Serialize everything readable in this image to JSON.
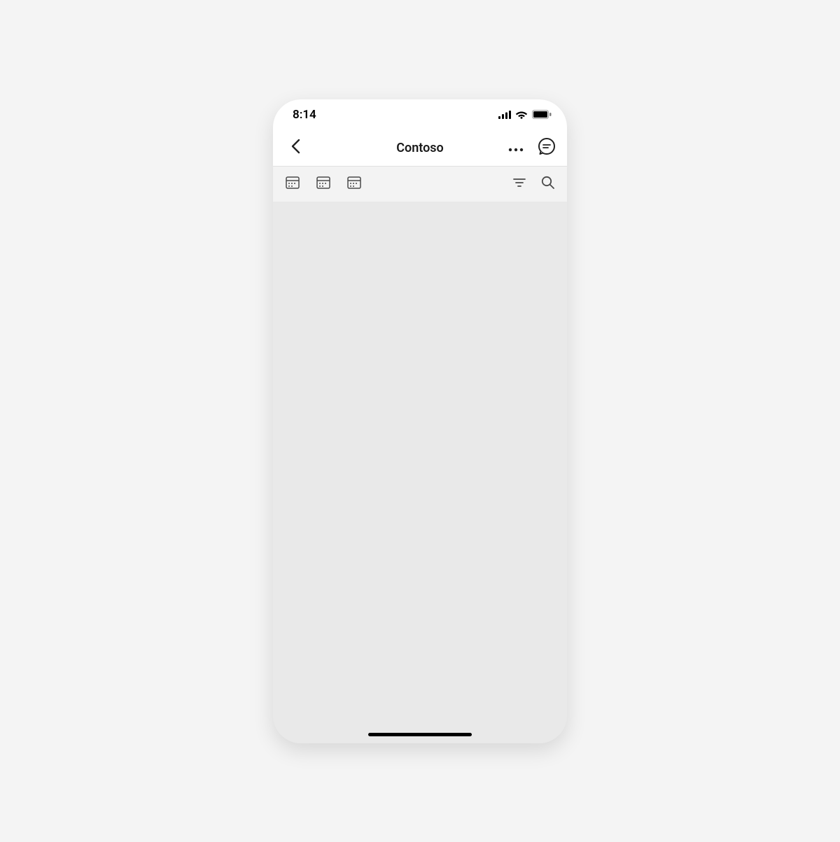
{
  "status": {
    "time": "8:14"
  },
  "nav": {
    "title": "Contoso"
  }
}
